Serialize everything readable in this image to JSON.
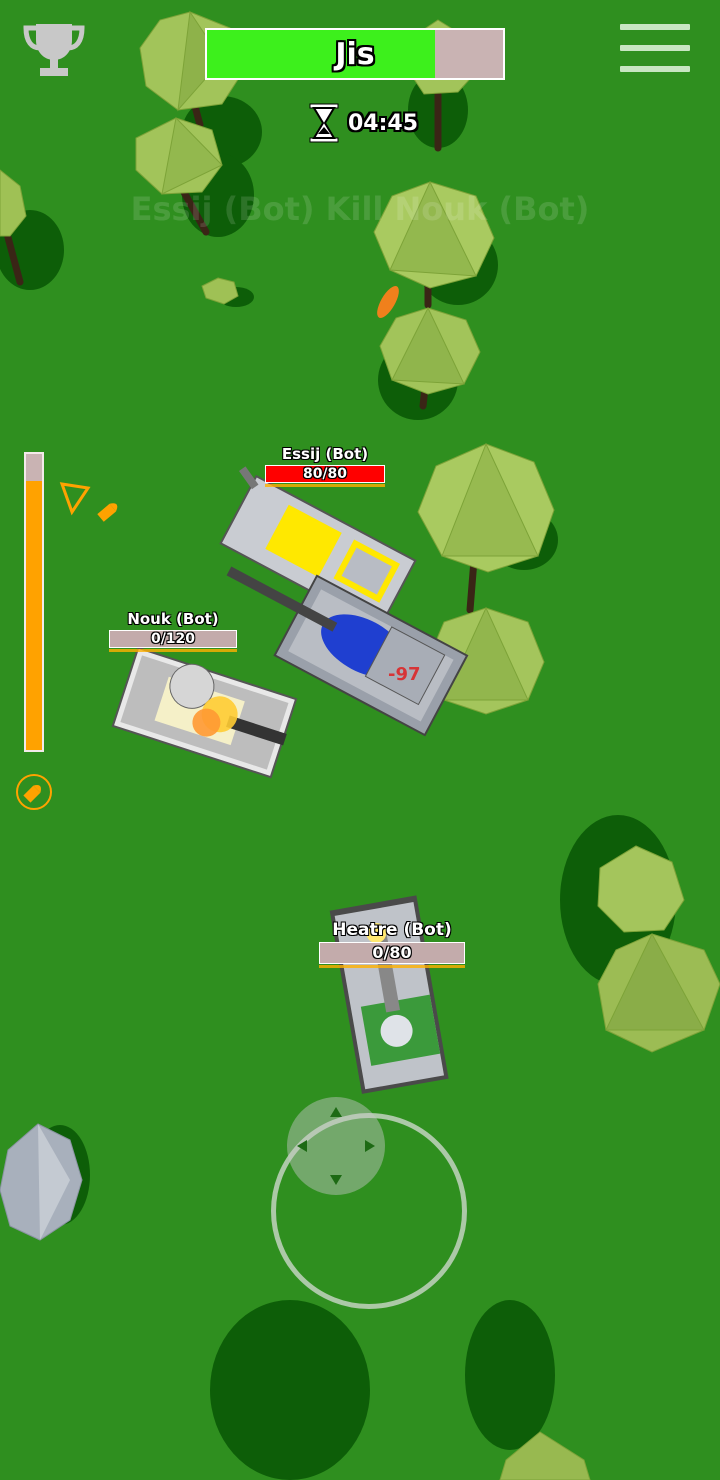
{
  "colors": {
    "grass": "#2f8f1f",
    "player_health": "#3df01c",
    "enemy_health": "#ff0000",
    "ammo": "#ffa200",
    "bar_empty": "#c3abab"
  },
  "hud": {
    "player": {
      "name": "Jis",
      "health_fraction": 0.77
    },
    "timer": {
      "icon": "hourglass-icon",
      "value": "04:45"
    },
    "killfeed": "Essij (Bot) Kill Nouk (Bot)",
    "menu_icon": "hamburger-menu-icon",
    "leaderboard_icon": "trophy-icon",
    "ammo": {
      "level_fraction": 0.91,
      "icon": "bullet-icon"
    },
    "damage_popup": "-97"
  },
  "enemies": [
    {
      "name": "Essij (Bot)",
      "health": "80/80",
      "health_fraction": 1.0
    },
    {
      "name": "Nouk (Bot)",
      "health": "0/120",
      "health_fraction": 0.0
    },
    {
      "name": "Heatre (Bot)",
      "health": "0/80",
      "health_fraction": 0.0
    }
  ],
  "joystick": {
    "icon": "dpad-arrows-icon"
  }
}
